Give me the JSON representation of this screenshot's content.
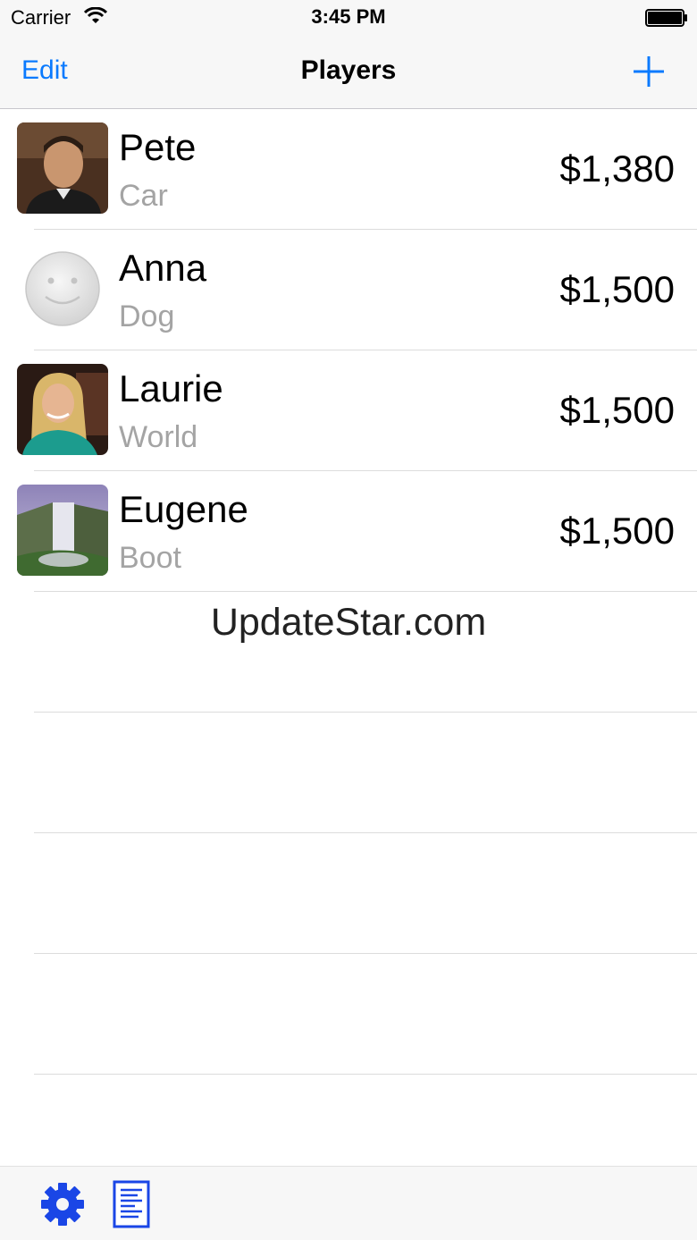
{
  "status_bar": {
    "carrier": "Carrier",
    "time": "3:45 PM",
    "wifi_icon": "wifi-icon",
    "battery_icon": "battery-full-icon"
  },
  "nav": {
    "edit_label": "Edit",
    "title": "Players",
    "add_icon": "plus-icon",
    "accent_color": "#0a7afe"
  },
  "players": [
    {
      "name": "Pete",
      "game": "Car",
      "score": "$1,380",
      "avatar": "photo-man"
    },
    {
      "name": "Anna",
      "game": "Dog",
      "score": "$1,500",
      "avatar": "smiley-placeholder"
    },
    {
      "name": "Laurie",
      "game": "World",
      "score": "$1,500",
      "avatar": "photo-woman"
    },
    {
      "name": "Eugene",
      "game": "Boot",
      "score": "$1,500",
      "avatar": "photo-waterfall"
    }
  ],
  "watermark": "UpdateStar.com",
  "toolbar": {
    "settings_icon": "gear-icon",
    "document_icon": "document-icon"
  }
}
